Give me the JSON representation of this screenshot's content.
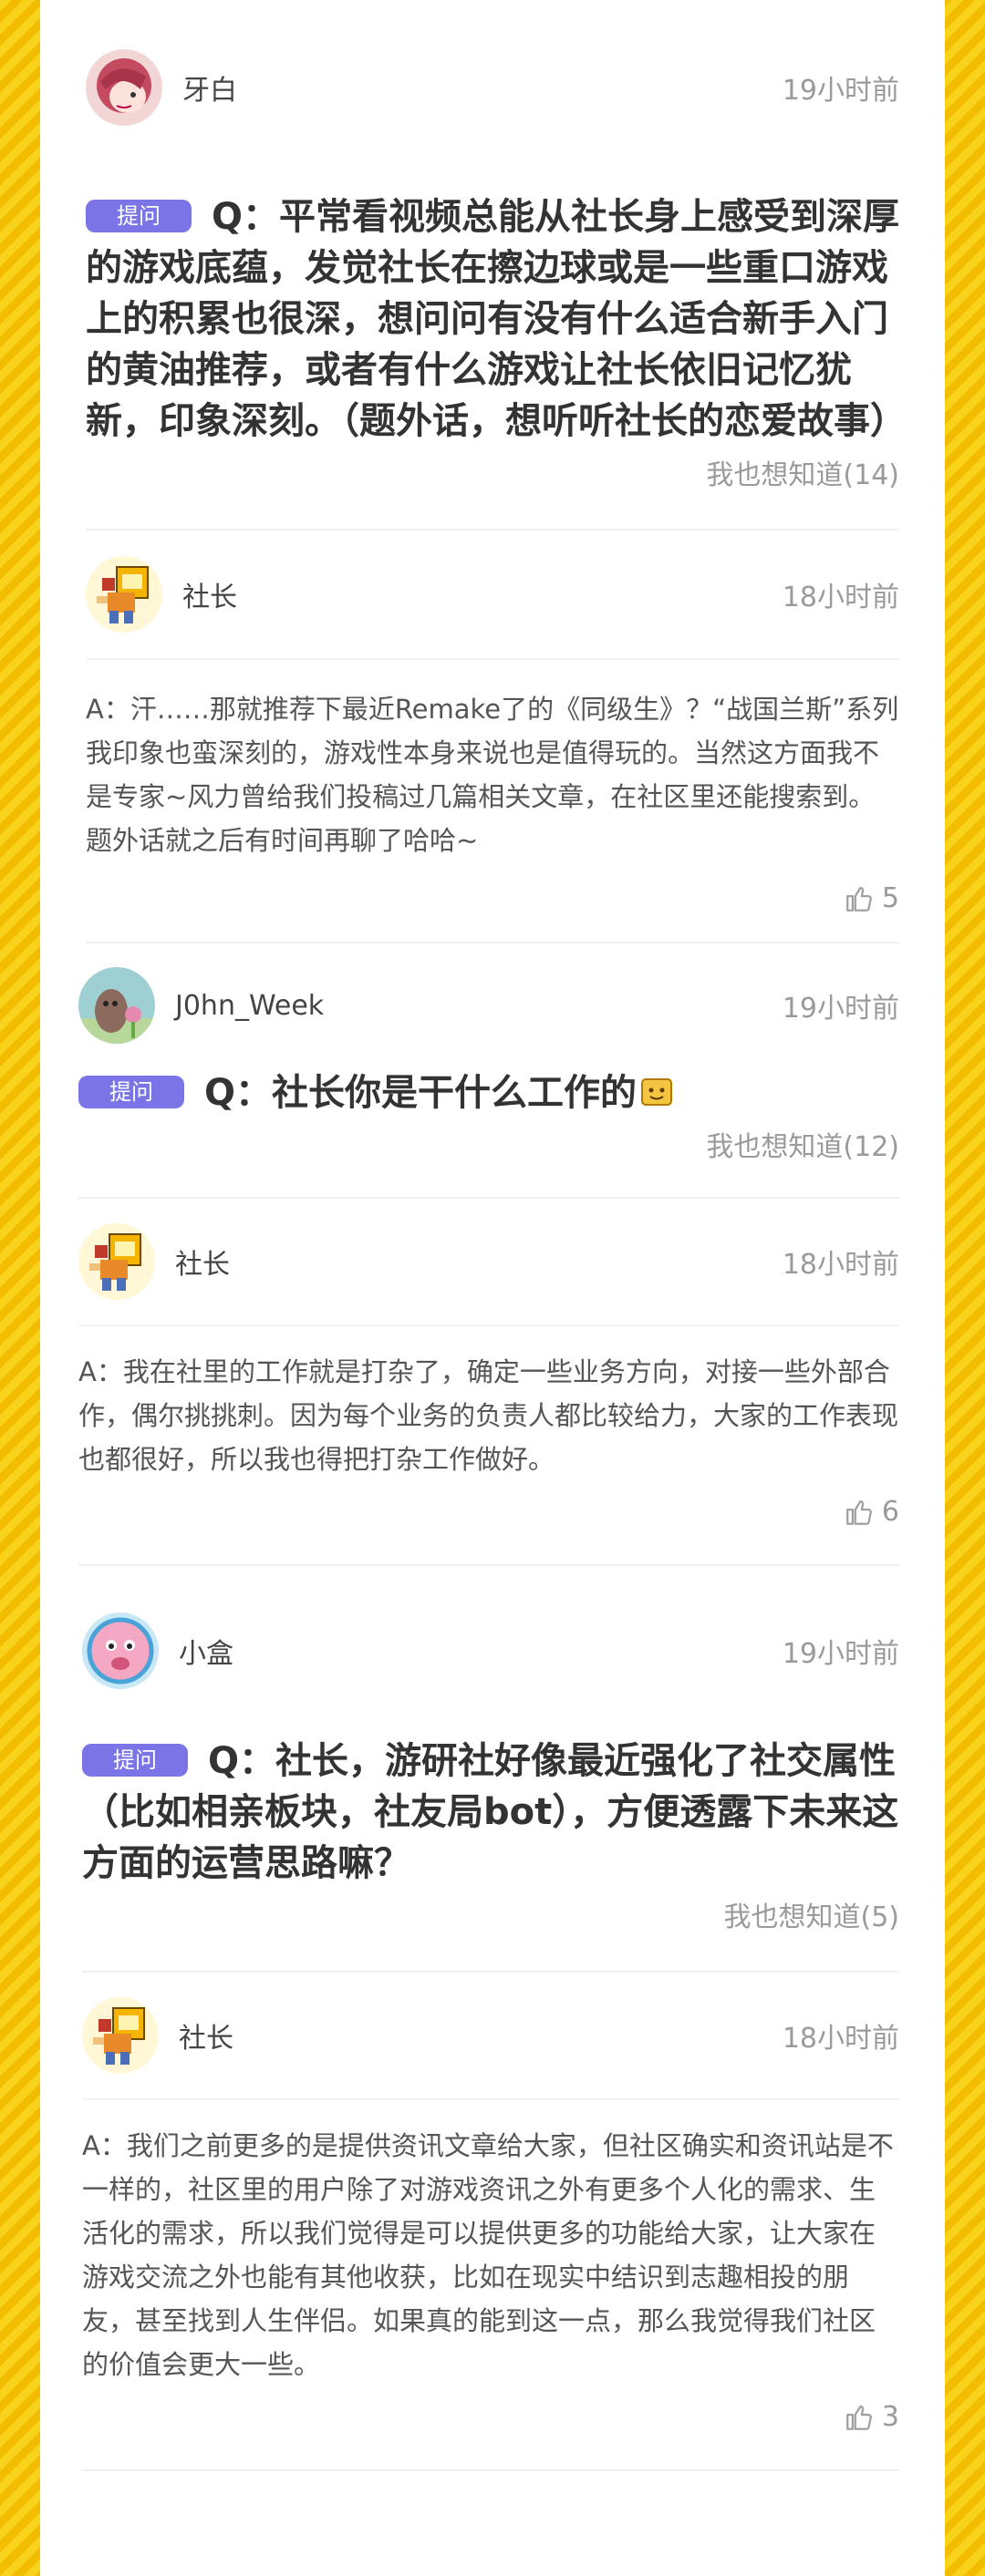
{
  "threads": [
    {
      "question": {
        "user": "牙白",
        "time": "19小时前",
        "tag": "提问",
        "text": "Q：平常看视频总能从社长身上感受到深厚的游戏底蕴，发觉社长在擦边球或是一些重口游戏上的积累也很深，想问问有没有什么适合新手入门的黄油推荐，或者有什么游戏让社长依旧记忆犹新，印象深刻。（题外话，想听听社长的恋爱故事）",
        "want": "我也想知道(14)"
      },
      "answer": {
        "user": "社长",
        "time": "18小时前",
        "text": "A：汗……那就推荐下最近Remake了的《同级生》？“战国兰斯”系列我印象也蛮深刻的，游戏性本身来说也是值得玩的。当然这方面我不是专家~风力曾给我们投稿过几篇相关文章，在社区里还能搜索到。题外话就之后有时间再聊了哈哈~",
        "likes": "5"
      }
    },
    {
      "question": {
        "user": "J0hn_Week",
        "time": "19小时前",
        "tag": "提问",
        "text": "Q：社长你是干什么工作的",
        "want": "我也想知道(12)"
      },
      "answer": {
        "user": "社长",
        "time": "18小时前",
        "text": "A：我在社里的工作就是打杂了，确定一些业务方向，对接一些外部合作，偶尔挑挑刺。因为每个业务的负责人都比较给力，大家的工作表现也都很好，所以我也得把打杂工作做好。",
        "likes": "6"
      }
    },
    {
      "question": {
        "user": "小盒",
        "time": "19小时前",
        "tag": "提问",
        "text": "Q：社长，游研社好像最近强化了社交属性（比如相亲板块，社友局bot），方便透露下未来这方面的运营思路嘛？",
        "want": "我也想知道(5)"
      },
      "answer": {
        "user": "社长",
        "time": "18小时前",
        "text": "A：我们之前更多的是提供资讯文章给大家，但社区确实和资讯站是不一样的，社区里的用户除了对游戏资讯之外有更多个人化的需求、生活化的需求，所以我们觉得是可以提供更多的功能给大家，让大家在游戏交流之外也能有其他收获，比如在现实中结识到志趣相投的朋友，甚至找到人生伴侣。如果真的能到这一点，那么我觉得我们社区的价值会更大一些。",
        "likes": "3"
      }
    }
  ]
}
